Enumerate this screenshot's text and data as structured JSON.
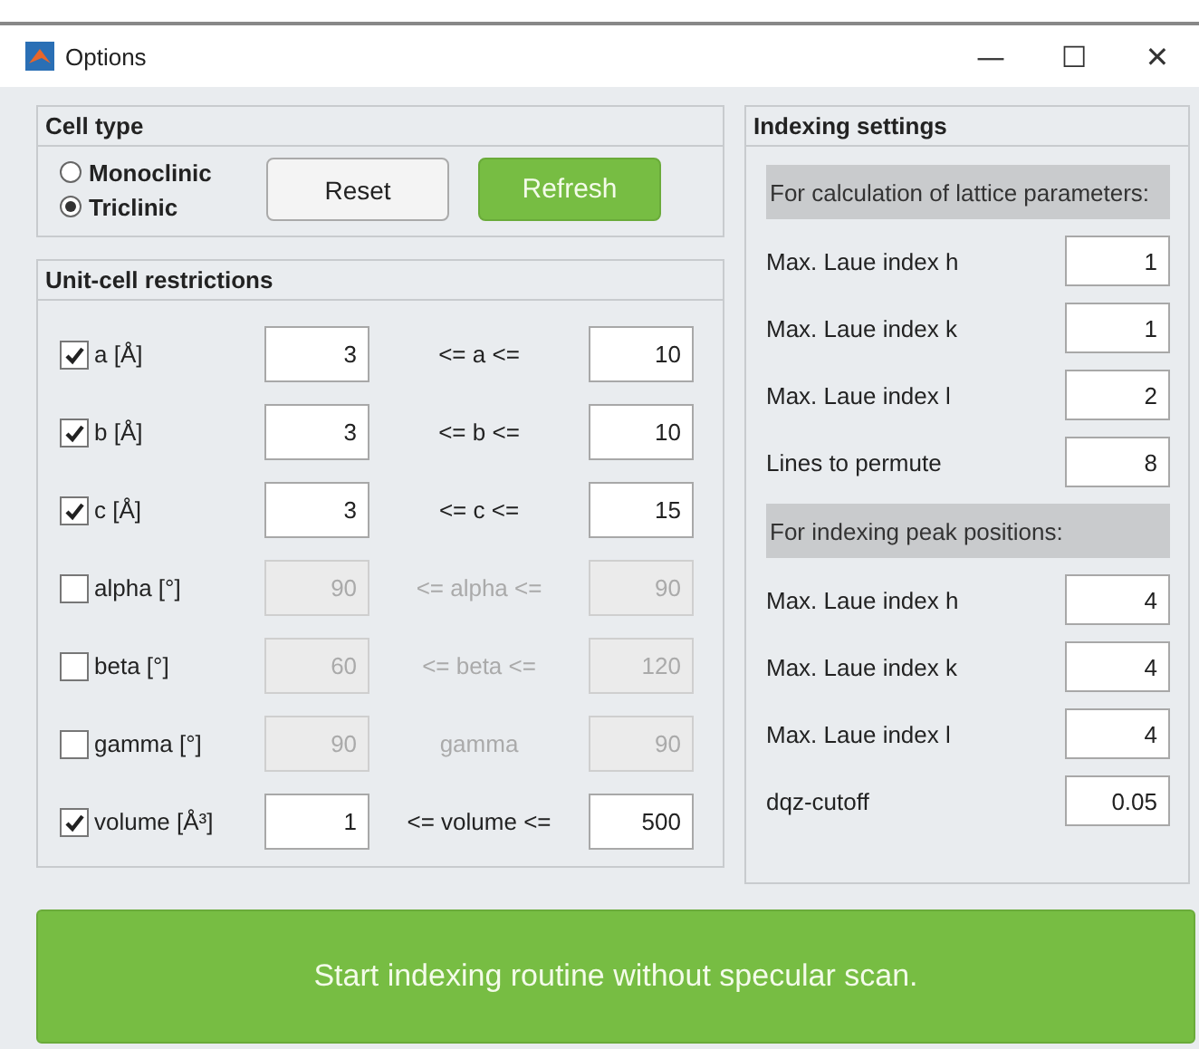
{
  "window": {
    "title": "Options",
    "controls": [
      "—",
      "☐",
      "✕"
    ]
  },
  "cell_type": {
    "title": "Cell type",
    "radios": [
      {
        "label": "Monoclinic",
        "selected": false
      },
      {
        "label": "Triclinic",
        "selected": true
      }
    ],
    "buttons": [
      {
        "label": "Reset",
        "kind": "plain"
      },
      {
        "label": "Refresh",
        "kind": "primary"
      }
    ]
  },
  "unit_cell_restrictions": {
    "title": "Unit-cell restrictions",
    "rows": [
      {
        "label": "a [Å]",
        "checked": true,
        "disabled": false,
        "min": "3",
        "relation": "<= a <=",
        "max": "10"
      },
      {
        "label": "b [Å]",
        "checked": true,
        "disabled": false,
        "min": "3",
        "relation": "<= b <=",
        "max": "10"
      },
      {
        "label": "c [Å]",
        "checked": true,
        "disabled": false,
        "min": "3",
        "relation": "<= c <=",
        "max": "15"
      },
      {
        "label": "alpha [°]",
        "checked": false,
        "disabled": true,
        "min": "90",
        "relation": "<= alpha <=",
        "max": "90"
      },
      {
        "label": "beta [°]",
        "checked": false,
        "disabled": true,
        "min": "60",
        "relation": "<= beta <=",
        "max": "120"
      },
      {
        "label": "gamma [°]",
        "checked": false,
        "disabled": true,
        "min": "90",
        "relation": "gamma",
        "max": "90"
      },
      {
        "label": "volume [Å³]",
        "checked": true,
        "disabled": false,
        "min": "1",
        "relation": "<= volume <=",
        "max": "500"
      }
    ]
  },
  "indexing_settings": {
    "title": "Indexing settings",
    "items": [
      {
        "kind": "heading",
        "label": "For calculation of lattice parameters:"
      },
      {
        "kind": "field",
        "label": "Max. Laue index h",
        "value": "1"
      },
      {
        "kind": "field",
        "label": "Max. Laue index k",
        "value": "1"
      },
      {
        "kind": "field",
        "label": "Max. Laue index l",
        "value": "2"
      },
      {
        "kind": "field",
        "label": "Lines to permute",
        "value": "8"
      },
      {
        "kind": "heading",
        "label": "For indexing peak positions:"
      },
      {
        "kind": "field",
        "label": "Max. Laue index h",
        "value": "4"
      },
      {
        "kind": "field",
        "label": "Max. Laue index k",
        "value": "4"
      },
      {
        "kind": "field",
        "label": "Max. Laue index l",
        "value": "4"
      },
      {
        "kind": "field",
        "label": "dqz-cutoff",
        "value": "0.05"
      }
    ]
  },
  "start_button": {
    "label": "Start indexing routine without specular scan."
  }
}
